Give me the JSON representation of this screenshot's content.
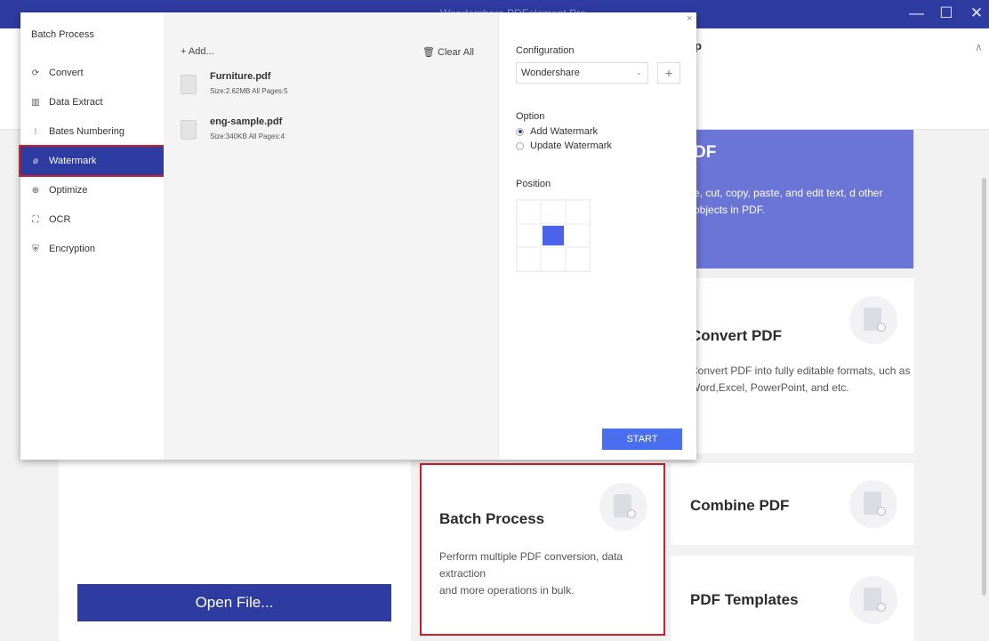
{
  "app": {
    "title": "Wondershare PDFelement Pro",
    "ribbon_partial": "p"
  },
  "window_controls": {
    "minimize": "—",
    "maximize": "☐",
    "close": "✕"
  },
  "home": {
    "open_file_label": "Open File...",
    "edit_card": {
      "title_partial": "DF",
      "desc_partial": "e, cut, copy, paste, and edit text, d other objects in PDF."
    },
    "convert_card": {
      "title_partial": "Convert PDF",
      "desc_partial": "Convert PDF into fully editable formats, uch as Word,Excel, PowerPoint, and etc."
    },
    "batch_card": {
      "title": "Batch Process",
      "desc_line1": "Perform multiple PDF conversion, data extraction",
      "desc_line2": "and more operations in bulk."
    },
    "combine_card": {
      "title": "Combine PDF"
    },
    "templates_card": {
      "title": "PDF Templates"
    }
  },
  "dialog": {
    "title": "Batch Process",
    "close": "×",
    "nav": [
      {
        "label": "Convert",
        "icon": "convert-icon",
        "glyph": "⟳"
      },
      {
        "label": "Data Extract",
        "icon": "data-extract-icon",
        "glyph": "▥"
      },
      {
        "label": "Bates Numbering",
        "icon": "bates-numbering-icon",
        "glyph": "⁝"
      },
      {
        "label": "Watermark",
        "icon": "watermark-icon",
        "glyph": "ø",
        "active": true
      },
      {
        "label": "Optimize",
        "icon": "optimize-icon",
        "glyph": "⊕"
      },
      {
        "label": "OCR",
        "icon": "ocr-icon",
        "glyph": "⛶"
      },
      {
        "label": "Encryption",
        "icon": "encryption-icon",
        "glyph": "⛨"
      }
    ],
    "add_label": "+ Add...",
    "clear_label": "🗑 Clear All",
    "files": [
      {
        "name": "Furniture.pdf",
        "meta": "Size:2.62MB   All Pages:5"
      },
      {
        "name": "eng-sample.pdf",
        "meta": "Size:340KB   All Pages:4"
      }
    ],
    "configuration_label": "Configuration",
    "configuration_value": "Wondershare",
    "option_label": "Option",
    "options": [
      {
        "label": "Add Watermark",
        "selected": true
      },
      {
        "label": "Update Watermark",
        "selected": false
      }
    ],
    "position_label": "Position",
    "position_selected": "middle-center",
    "start_label": "START"
  },
  "colors": {
    "brand": "#2e3ba0",
    "accent": "#4a6ef0",
    "highlight_outline": "#d11e2a",
    "edit_card_bg": "#6a75d6"
  }
}
